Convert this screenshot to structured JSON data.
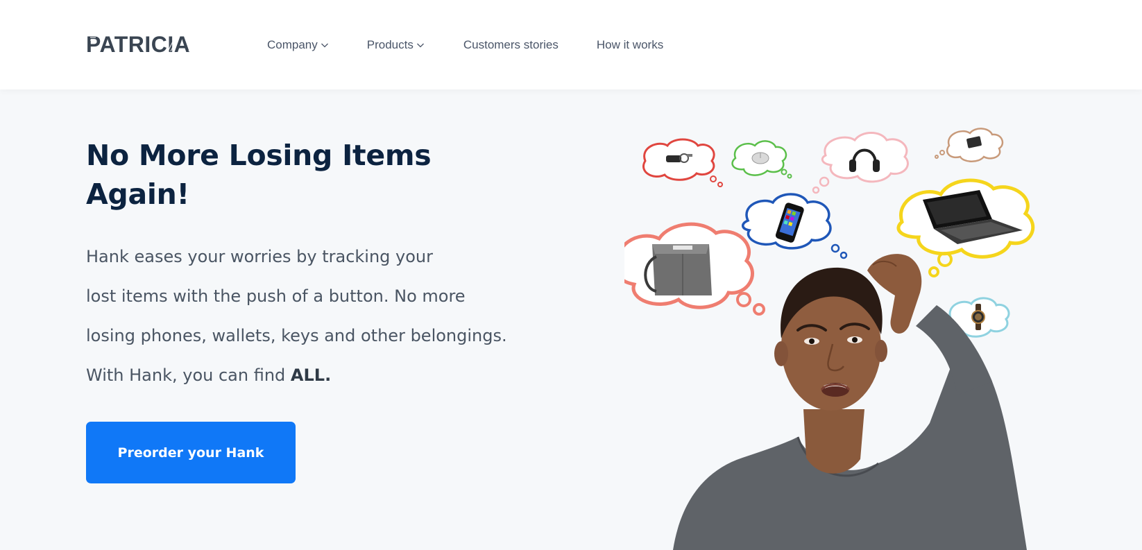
{
  "brand": {
    "logo_text": "PATRICIA"
  },
  "nav": {
    "items": [
      {
        "label": "Company",
        "has_dropdown": true
      },
      {
        "label": "Products",
        "has_dropdown": true
      },
      {
        "label": "Customers stories",
        "has_dropdown": false
      },
      {
        "label": "How it works",
        "has_dropdown": false
      }
    ]
  },
  "hero": {
    "title_line1": "No More Losing Items",
    "title_line2": "Again!",
    "desc_line1": "Hank eases your worries by tracking your",
    "desc_line2": "lost items with the push of a button. No more",
    "desc_line3": "losing phones, wallets, keys and other belongings.",
    "desc_line4_prefix": "With Hank, you can find ",
    "desc_line4_bold": "ALL.",
    "cta_label": "Preorder your Hank"
  },
  "illustration": {
    "thought_items": [
      {
        "item": "keys-icon",
        "color": "#e0463f"
      },
      {
        "item": "mouse-icon",
        "color": "#5bbf4a"
      },
      {
        "item": "headphones-icon",
        "color": "#f4b7bd"
      },
      {
        "item": "wallet-icon",
        "color": "#c89a7a"
      },
      {
        "item": "phone-icon",
        "color": "#1f57b8"
      },
      {
        "item": "laptop-icon",
        "color": "#f5d51c"
      },
      {
        "item": "bag-icon",
        "color": "#ef7d70"
      },
      {
        "item": "watch-icon",
        "color": "#8fd2e0"
      }
    ]
  },
  "colors": {
    "primary": "#1078f7",
    "heading": "#0c2340",
    "body_text": "#4a5563",
    "page_bg": "#f6f8fa",
    "header_bg": "#ffffff"
  }
}
